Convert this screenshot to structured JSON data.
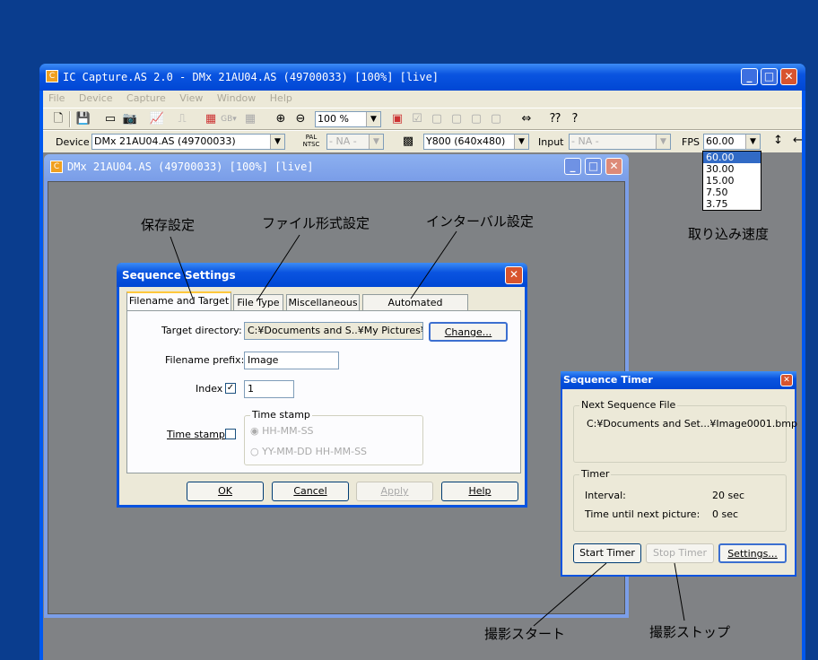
{
  "main_window": {
    "title": "IC Capture.AS 2.0 - DMx 21AU04.AS (49700033) [100%]  [live]",
    "menu": [
      "File",
      "Device",
      "Capture",
      "View",
      "Window",
      "Help"
    ],
    "zoom": "100 %",
    "toolbar2": {
      "device_label": "Device",
      "device_value": "DMx 21AU04.AS (49700033)",
      "pal_ntsc": "PAL NTSC",
      "norm_value": "- NA -",
      "format_value": "Y800 (640x480)",
      "input_label": "Input",
      "input_value": "- NA -",
      "fps_label": "FPS",
      "fps_value": "60.00"
    },
    "fps_options": [
      "60.00",
      "30.00",
      "15.00",
      "7.50",
      "3.75"
    ]
  },
  "child_window": {
    "title": "DMx 21AU04.AS (49700033) [100%]  [live]"
  },
  "sequence_settings": {
    "title": "Sequence Settings",
    "tabs": [
      "Filename and Target",
      "File Type",
      "Miscellaneous",
      "Automated Sequence"
    ],
    "target_dir_label": "Target directory:",
    "target_dir_value": "C:¥Documents and S..¥My Pictures¥",
    "change_button": "Change...",
    "prefix_label": "Filename prefix:",
    "prefix_value": "Image",
    "index_label": "Index",
    "index_check": "✓",
    "index_value": "1",
    "timestamp_label": "Time stamp",
    "timestamp_group": "Time stamp",
    "radio1": "HH-MM-SS",
    "radio2": "YY-MM-DD HH-MM-SS",
    "ok": "OK",
    "cancel": "Cancel",
    "apply": "Apply",
    "help": "Help"
  },
  "sequence_timer": {
    "title": "Sequence Timer",
    "next_group": "Next Sequence File",
    "next_file": "C:¥Documents and Set...¥Image0001.bmp",
    "timer_group": "Timer",
    "interval_label": "Interval:",
    "interval_value": "20 sec",
    "until_label": "Time until next picture:",
    "until_value": "0 sec",
    "start": "Start Timer",
    "stop": "Stop Timer",
    "settings": "Settings..."
  },
  "annotations": {
    "save_settings": "保存設定",
    "file_format": "ファイル形式設定",
    "interval": "インターバル設定",
    "capture_speed": "取り込み速度",
    "start": "撮影スタート",
    "stop": "撮影ストップ"
  }
}
